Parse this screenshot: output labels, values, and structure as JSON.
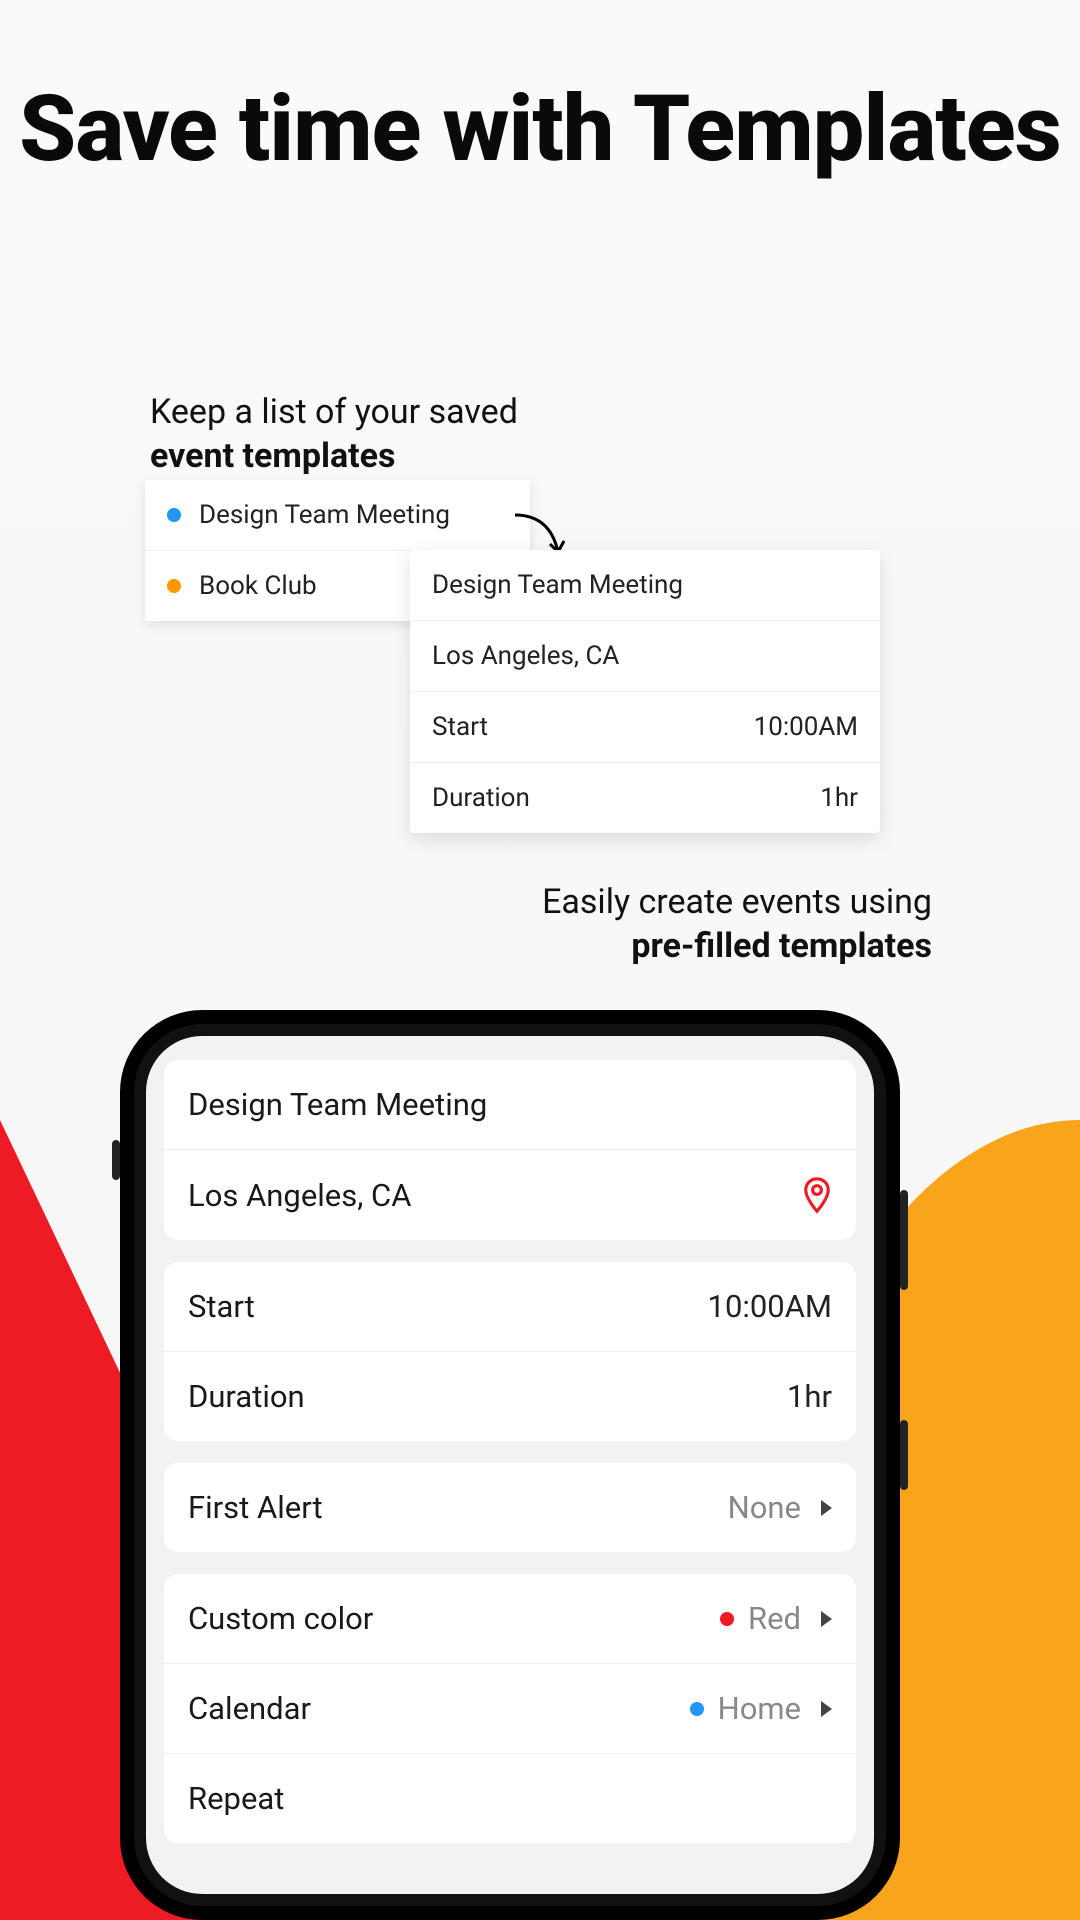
{
  "title": "Save time with Templates",
  "subtitle1": {
    "line1": "Keep a list of your saved",
    "line2": "event templates"
  },
  "subtitle2": {
    "line1": "Easily create events using",
    "line2": "pre-filled templates"
  },
  "templateList": {
    "items": [
      {
        "label": "Design Team Meeting",
        "color": "blue"
      },
      {
        "label": "Book Club",
        "color": "orange"
      }
    ]
  },
  "templateDetail": {
    "title": "Design Team Meeting",
    "location": "Los Angeles, CA",
    "startLabel": "Start",
    "startValue": "10:00AM",
    "durationLabel": "Duration",
    "durationValue": "1hr"
  },
  "phoneForm": {
    "title": "Design Team Meeting",
    "location": "Los Angeles, CA",
    "startLabel": "Start",
    "startValue": "10:00AM",
    "durationLabel": "Duration",
    "durationValue": "1hr",
    "firstAlertLabel": "First Alert",
    "firstAlertValue": "None",
    "customColorLabel": "Custom color",
    "customColorValue": "Red",
    "calendarLabel": "Calendar",
    "calendarValue": "Home",
    "repeatLabel": "Repeat"
  },
  "colors": {
    "accentRed": "#ed1c24",
    "accentYellow": "#f8a51b",
    "dotBlue": "#2196f3",
    "dotOrange": "#ff9800"
  }
}
